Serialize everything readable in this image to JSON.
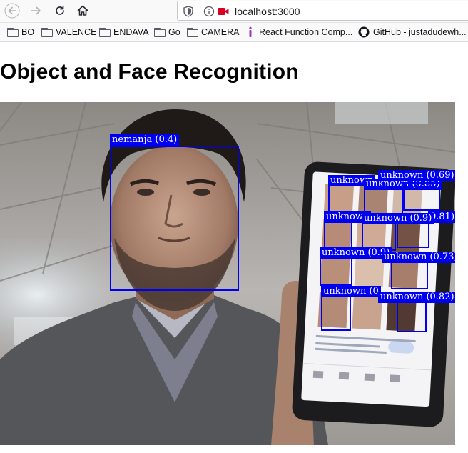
{
  "browser": {
    "url": "localhost:3000",
    "bookmarks": [
      {
        "label": "BO",
        "type": "folder"
      },
      {
        "label": "VALENCE",
        "type": "folder"
      },
      {
        "label": "ENDAVA",
        "type": "folder"
      },
      {
        "label": "Go",
        "type": "folder"
      },
      {
        "label": "CAMERA",
        "type": "folder"
      },
      {
        "label": "React Function Comp...",
        "type": "link",
        "icon": "react-docs-icon"
      },
      {
        "label": "GitHub - justadudewh...",
        "type": "link",
        "icon": "github-icon"
      }
    ]
  },
  "page": {
    "title": "Object and Face Recognition"
  },
  "detections": [
    {
      "label": "nemanja (0.4)"
    },
    {
      "label": "unknown"
    },
    {
      "label": "unknown (0.69)"
    },
    {
      "label": "unknown (0.85)"
    },
    {
      "label": "unknown"
    },
    {
      "label": "unknown (0.9)"
    },
    {
      "label": "0.81)"
    },
    {
      "label": "unknown (0.9)"
    },
    {
      "label": "unknown (0.73)"
    },
    {
      "label": "unknown (0"
    },
    {
      "label": "unknown (0.82)"
    }
  ],
  "colors": {
    "detection": "#0000f0",
    "recording-indicator": "#d70022"
  }
}
